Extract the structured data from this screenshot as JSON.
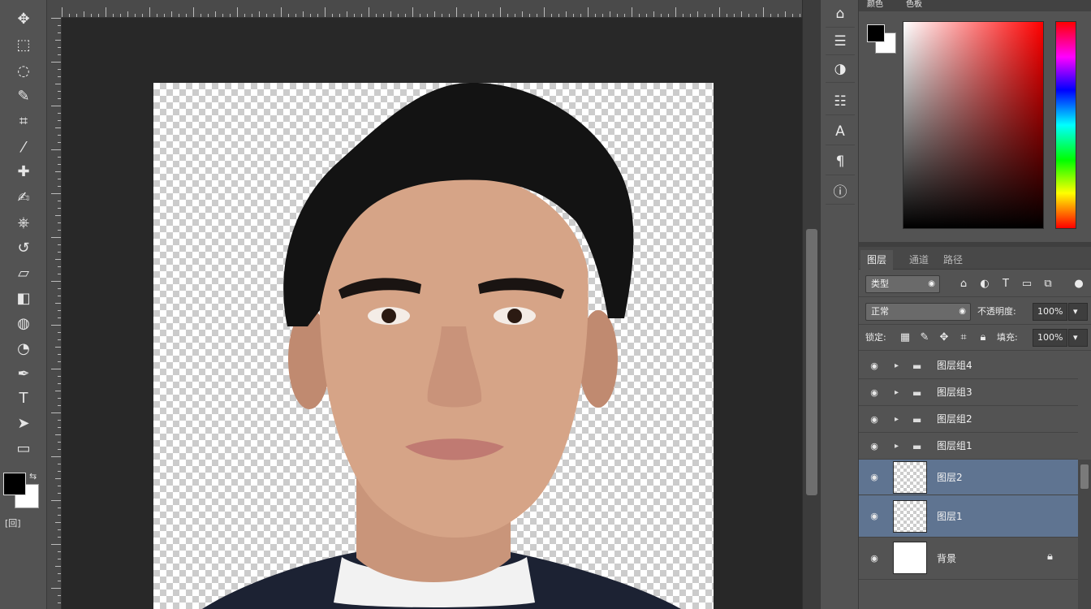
{
  "toolbar": {
    "tools": [
      {
        "id": "move",
        "icon": "move-icon",
        "glyph": "✥"
      },
      {
        "id": "marquee",
        "icon": "rect-marquee-icon",
        "glyph": "⬚"
      },
      {
        "id": "lasso",
        "icon": "lasso-icon",
        "glyph": "◌"
      },
      {
        "id": "quick-select",
        "icon": "quick-select-icon",
        "glyph": "✎"
      },
      {
        "id": "crop",
        "icon": "crop-icon",
        "glyph": "⌗"
      },
      {
        "id": "eyedropper",
        "icon": "eyedropper-icon",
        "glyph": "⁄"
      },
      {
        "id": "healing",
        "icon": "healing-brush-icon",
        "glyph": "✚"
      },
      {
        "id": "brush",
        "icon": "brush-icon",
        "glyph": "✍"
      },
      {
        "id": "clone",
        "icon": "clone-stamp-icon",
        "glyph": "⎈"
      },
      {
        "id": "history-brush",
        "icon": "history-brush-icon",
        "glyph": "↺"
      },
      {
        "id": "eraser",
        "icon": "eraser-icon",
        "glyph": "▱"
      },
      {
        "id": "gradient",
        "icon": "gradient-icon",
        "glyph": "◧"
      },
      {
        "id": "blur",
        "icon": "blur-icon",
        "glyph": "◍"
      },
      {
        "id": "dodge",
        "icon": "dodge-icon",
        "glyph": "◔"
      },
      {
        "id": "pen",
        "icon": "pen-icon",
        "glyph": "✒"
      },
      {
        "id": "type",
        "icon": "type-icon",
        "glyph": "T"
      },
      {
        "id": "path-select",
        "icon": "path-select-icon",
        "glyph": "➤"
      },
      {
        "id": "shape",
        "icon": "shape-icon",
        "glyph": "▭"
      }
    ],
    "quickmask_label": "[回]"
  },
  "strip_icons": [
    {
      "icon": "history-icon",
      "glyph": "⌂"
    },
    {
      "icon": "properties-icon",
      "glyph": "☰"
    },
    {
      "icon": "adjustments-icon",
      "glyph": "◑"
    },
    {
      "icon": "brushes-icon",
      "glyph": "☷"
    },
    {
      "icon": "character-icon",
      "glyph": "A"
    },
    {
      "icon": "paragraph-icon",
      "glyph": "¶"
    },
    {
      "icon": "info-icon",
      "glyph": "ⓘ"
    }
  ],
  "color_panel": {
    "tabs": [
      "颜色",
      "色板"
    ],
    "foreground": "#000000",
    "background": "#ffffff"
  },
  "layers_panel": {
    "tabs": [
      "图层",
      "通道",
      "路径"
    ],
    "filter_kind": "类型",
    "blend_mode": "正常",
    "opacity_label": "不透明度:",
    "opacity_value": "100%",
    "lock_label": "锁定:",
    "fill_label": "填充:",
    "fill_value": "100%",
    "layers": [
      {
        "name": "图层组4",
        "type": "group",
        "selected": false
      },
      {
        "name": "图层组3",
        "type": "group",
        "selected": false
      },
      {
        "name": "图层组2",
        "type": "group",
        "selected": false
      },
      {
        "name": "图层组1",
        "type": "group",
        "selected": false
      },
      {
        "name": "图层2",
        "type": "layer",
        "selected": true
      },
      {
        "name": "图层1",
        "type": "layer",
        "selected": true
      },
      {
        "name": "背景",
        "type": "background",
        "selected": false
      }
    ]
  }
}
